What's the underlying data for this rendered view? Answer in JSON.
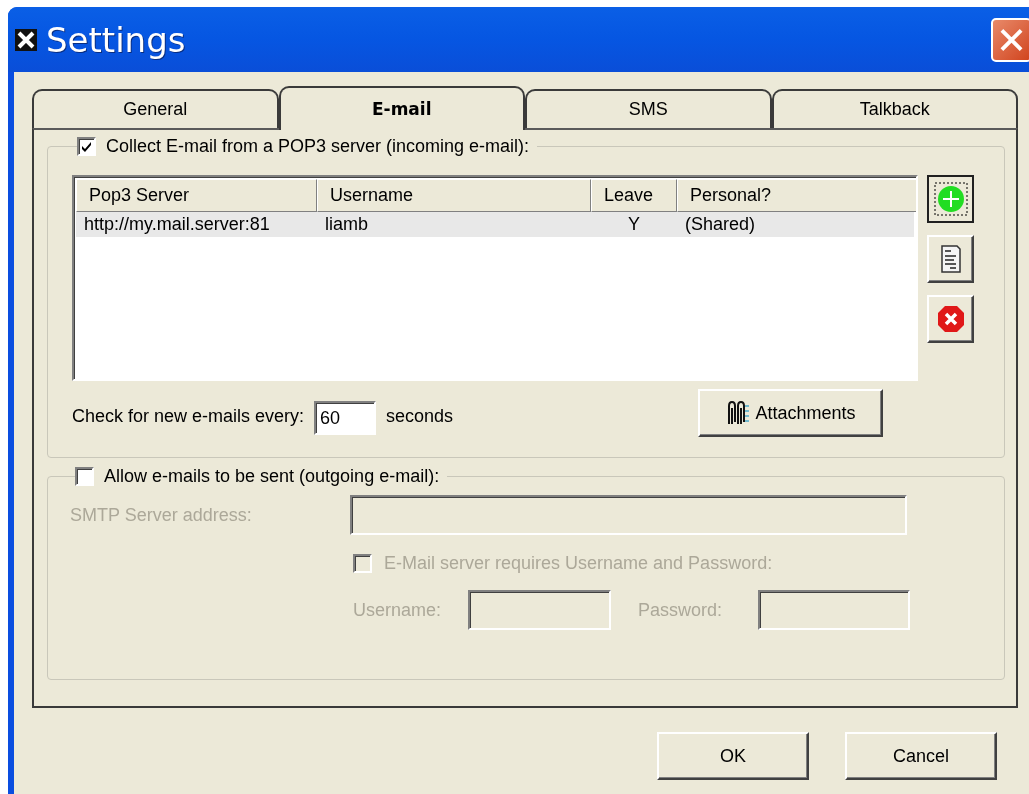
{
  "window": {
    "title": "Settings"
  },
  "tabs": [
    {
      "label": "General",
      "selected": false
    },
    {
      "label": "E-mail",
      "selected": true
    },
    {
      "label": "SMS",
      "selected": false
    },
    {
      "label": "Talkback",
      "selected": false
    }
  ],
  "incoming": {
    "label": "Collect E-mail from a POP3 server (incoming e-mail):",
    "checked": true,
    "table": {
      "columns": [
        "Pop3 Server",
        "Username",
        "Leave",
        "Personal?"
      ],
      "rows": [
        {
          "cells": [
            "http://my.mail.server:81",
            "liamb",
            "Y",
            "(Shared)"
          ],
          "selected": true
        }
      ]
    },
    "interval_label": "Check for new e-mails every:",
    "interval_value": "60",
    "interval_unit": "seconds",
    "attachments_button": "Attachments"
  },
  "outgoing": {
    "label": "Allow e-mails to be sent (outgoing e-mail):",
    "checked": false,
    "smtp_label": "SMTP Server address:",
    "auth": {
      "label": "E-Mail server requires Username and Password:",
      "checked": false
    },
    "username_label": "Username:",
    "password_label": "Password:"
  },
  "buttons": [
    "OK",
    "Cancel"
  ]
}
